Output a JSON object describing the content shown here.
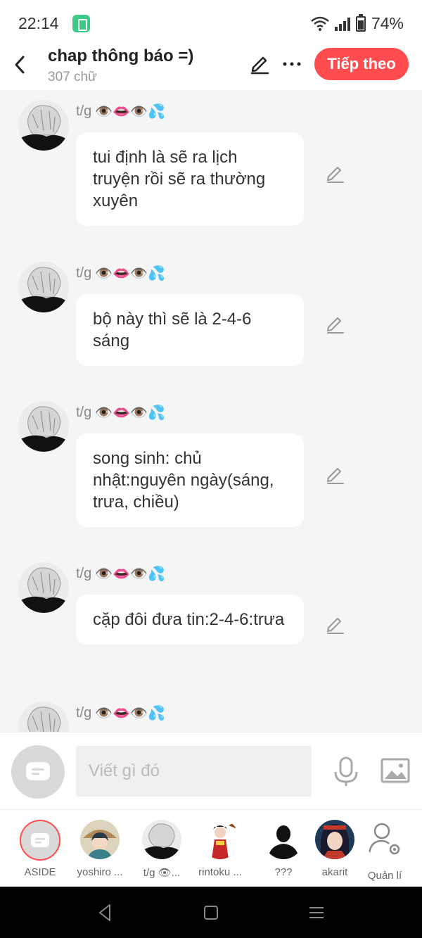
{
  "status_bar": {
    "time": "22:14",
    "battery": "74%"
  },
  "header": {
    "title": "chap thông báo =)",
    "word_count": "307 chữ",
    "next_button": "Tiếp theo"
  },
  "sender_emoji": "👁️👄👁️💦",
  "messages": [
    {
      "sender": "t/g",
      "text": "tui định là sẽ ra lịch truyện rồi sẽ ra thường xuyên"
    },
    {
      "sender": "t/g",
      "text": "bộ này thì sẽ là 2-4-6 sáng"
    },
    {
      "sender": "t/g",
      "text": "song sinh: chủ nhật:nguyên ngày(sáng, trưa, chiều)"
    },
    {
      "sender": "t/g",
      "text": "cặp đôi đưa tin:2-4-6:trưa"
    },
    {
      "sender": "t/g"
    }
  ],
  "input": {
    "placeholder": "Viết gì đó"
  },
  "characters": [
    {
      "name": "ASIDE"
    },
    {
      "name": "yoshiro ..."
    },
    {
      "name": "t/g 👁..."
    },
    {
      "name": "rintoku ..."
    },
    {
      "name": "???"
    },
    {
      "name": "akarit"
    },
    {
      "name": "Quản lí"
    }
  ],
  "colors": {
    "accent": "#ff4d4f",
    "background": "#f5f5f5"
  }
}
